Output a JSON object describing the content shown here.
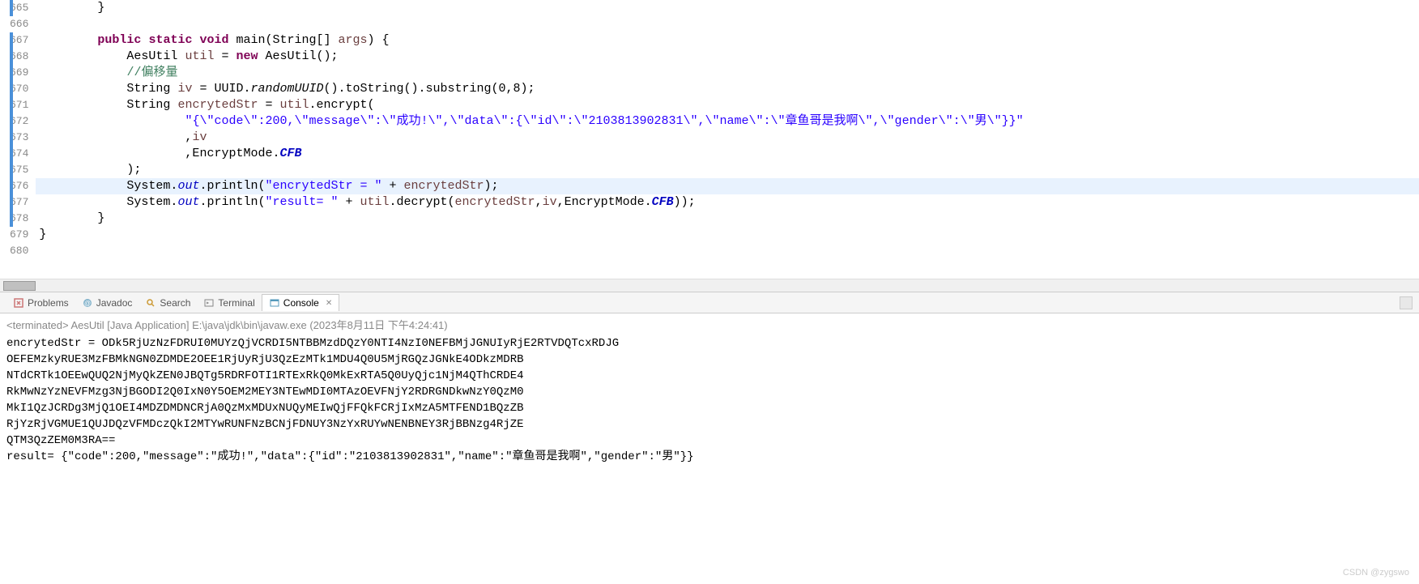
{
  "gutter": {
    "start": 665,
    "end": 680,
    "markers": [
      665,
      667,
      668,
      669,
      670,
      671,
      672,
      673,
      674,
      675,
      676,
      677,
      678
    ],
    "collapse": 667
  },
  "code": {
    "lines": [
      {
        "n": 665,
        "indent": "        ",
        "tokens": [
          {
            "t": "}",
            "c": ""
          }
        ]
      },
      {
        "n": 666,
        "indent": "",
        "tokens": []
      },
      {
        "n": 667,
        "indent": "        ",
        "tokens": [
          {
            "t": "public",
            "c": "kw"
          },
          {
            "t": " ",
            "c": ""
          },
          {
            "t": "static",
            "c": "kw"
          },
          {
            "t": " ",
            "c": ""
          },
          {
            "t": "void",
            "c": "kw"
          },
          {
            "t": " main(String[] ",
            "c": ""
          },
          {
            "t": "args",
            "c": "var"
          },
          {
            "t": ") {",
            "c": ""
          }
        ]
      },
      {
        "n": 668,
        "indent": "            ",
        "tokens": [
          {
            "t": "AesUtil ",
            "c": ""
          },
          {
            "t": "util",
            "c": "var"
          },
          {
            "t": " = ",
            "c": ""
          },
          {
            "t": "new",
            "c": "kw"
          },
          {
            "t": " AesUtil();",
            "c": ""
          }
        ]
      },
      {
        "n": 669,
        "indent": "            ",
        "tokens": [
          {
            "t": "//偏移量",
            "c": "comment"
          }
        ]
      },
      {
        "n": 670,
        "indent": "            ",
        "tokens": [
          {
            "t": "String ",
            "c": ""
          },
          {
            "t": "iv",
            "c": "var"
          },
          {
            "t": " = UUID.",
            "c": ""
          },
          {
            "t": "randomUUID",
            "c": "method-static"
          },
          {
            "t": "().toString().substring(0,8);",
            "c": ""
          }
        ]
      },
      {
        "n": 671,
        "indent": "            ",
        "tokens": [
          {
            "t": "String ",
            "c": ""
          },
          {
            "t": "encrytedStr",
            "c": "var"
          },
          {
            "t": " = ",
            "c": ""
          },
          {
            "t": "util",
            "c": "var"
          },
          {
            "t": ".encrypt(",
            "c": ""
          }
        ]
      },
      {
        "n": 672,
        "indent": "                    ",
        "tokens": [
          {
            "t": "\"{\\\"code\\\":200,\\\"message\\\":\\\"成功!\\\",\\\"data\\\":{\\\"id\\\":\\\"2103813902831\\\",\\\"name\\\":\\\"章鱼哥是我啊\\\",\\\"gender\\\":\\\"男\\\"}}\"",
            "c": "str"
          }
        ]
      },
      {
        "n": 673,
        "indent": "                    ",
        "tokens": [
          {
            "t": ",",
            "c": ""
          },
          {
            "t": "iv",
            "c": "var"
          }
        ]
      },
      {
        "n": 674,
        "indent": "                    ",
        "tokens": [
          {
            "t": ",EncryptMode.",
            "c": ""
          },
          {
            "t": "CFB",
            "c": "static-field-bold"
          }
        ]
      },
      {
        "n": 675,
        "indent": "            ",
        "tokens": [
          {
            "t": ");",
            "c": ""
          }
        ]
      },
      {
        "n": 676,
        "indent": "            ",
        "hl": true,
        "tokens": [
          {
            "t": "System.",
            "c": ""
          },
          {
            "t": "out",
            "c": "static-field"
          },
          {
            "t": ".println(",
            "c": ""
          },
          {
            "t": "\"encrytedStr = \"",
            "c": "str"
          },
          {
            "t": " + ",
            "c": ""
          },
          {
            "t": "encrytedStr",
            "c": "var"
          },
          {
            "t": ");",
            "c": ""
          }
        ]
      },
      {
        "n": 677,
        "indent": "            ",
        "tokens": [
          {
            "t": "System.",
            "c": ""
          },
          {
            "t": "out",
            "c": "static-field"
          },
          {
            "t": ".println(",
            "c": ""
          },
          {
            "t": "\"result= \"",
            "c": "str"
          },
          {
            "t": " + ",
            "c": ""
          },
          {
            "t": "util",
            "c": "var"
          },
          {
            "t": ".decrypt(",
            "c": ""
          },
          {
            "t": "encrytedStr",
            "c": "var"
          },
          {
            "t": ",",
            "c": ""
          },
          {
            "t": "iv",
            "c": "var"
          },
          {
            "t": ",EncryptMode.",
            "c": ""
          },
          {
            "t": "CFB",
            "c": "static-field-bold"
          },
          {
            "t": "));",
            "c": ""
          }
        ]
      },
      {
        "n": 678,
        "indent": "        ",
        "tokens": [
          {
            "t": "}",
            "c": ""
          }
        ]
      },
      {
        "n": 679,
        "indent": "",
        "tokens": [
          {
            "t": "}",
            "c": ""
          }
        ]
      },
      {
        "n": 680,
        "indent": "",
        "tokens": []
      }
    ]
  },
  "tabs": {
    "problems": "Problems",
    "javadoc": "Javadoc",
    "search": "Search",
    "terminal": "Terminal",
    "console": "Console"
  },
  "console": {
    "header": "<terminated> AesUtil [Java Application] E:\\java\\jdk\\bin\\javaw.exe (2023年8月11日 下午4:24:41)",
    "lines": [
      "encrytedStr = ODk5RjUzNzFDRUI0MUYzQjVCRDI5NTBBMzdDQzY0NTI4NzI0NEFBMjJGNUIyRjE2RTVDQTcxRDJG",
      "OEFEMzkyRUE3MzFBMkNGN0ZDMDE2OEE1RjUyRjU3QzEzMTk1MDU4Q0U5MjRGQzJGNkE4ODkzMDRB",
      "NTdCRTk1OEEwQUQ2NjMyQkZEN0JBQTg5RDRFOTI1RTExRkQ0MkExRTA5Q0UyQjc1NjM4QThCRDE4",
      "RkMwNzYzNEVFMzg3NjBGODI2Q0IxN0Y5OEM2MEY3NTEwMDI0MTAzOEVFNjY2RDRGNDkwNzY0QzM0",
      "MkI1QzJCRDg3MjQ1OEI4MDZDMDNCRjA0QzMxMDUxNUQyMEIwQjFFQkFCRjIxMzA5MTFEND1BQzZB",
      "RjYzRjVGMUE1QUJDQzVFMDczQkI2MTYwRUNFNzBCNjFDNUY3NzYxRUYwNENBNEY3RjBBNzg4RjZE",
      "QTM3QzZEM0M3RA==",
      "result= {\"code\":200,\"message\":\"成功!\",\"data\":{\"id\":\"2103813902831\",\"name\":\"章鱼哥是我啊\",\"gender\":\"男\"}}"
    ]
  },
  "watermark": "CSDN @zygswo"
}
